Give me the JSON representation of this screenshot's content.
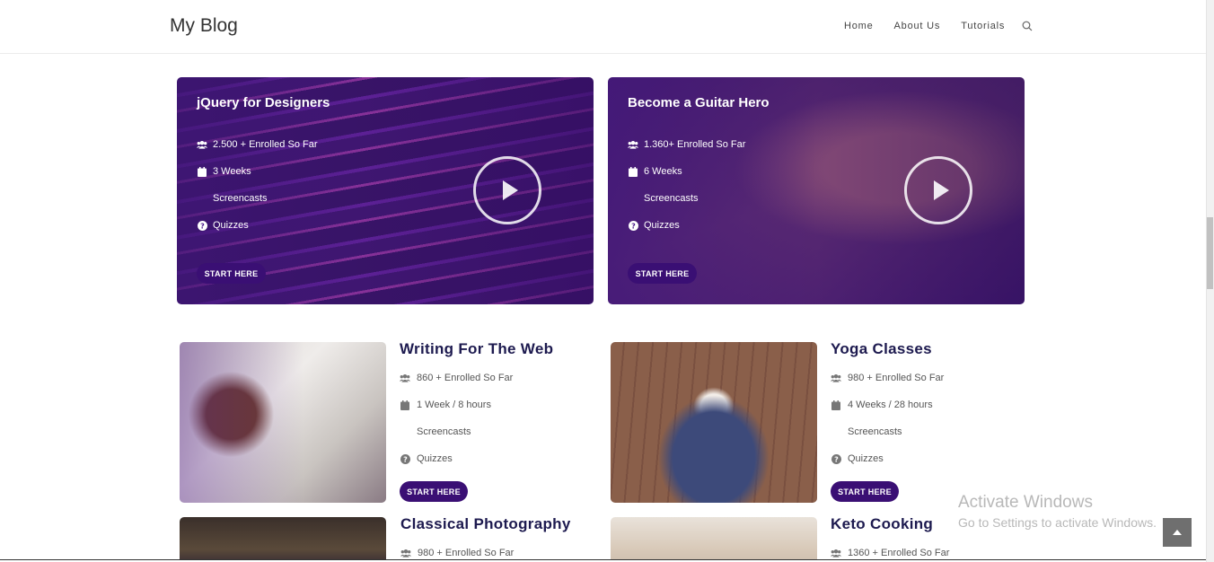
{
  "header": {
    "logo": "My Blog",
    "nav": [
      "Home",
      "About Us",
      "Tutorials"
    ],
    "search_icon": "search-icon"
  },
  "featured": [
    {
      "title": "jQuery for Designers",
      "enrolled": "2.500 + Enrolled So Far",
      "duration": "3 Weeks",
      "screencasts": "Screencasts",
      "quizzes": "Quizzes",
      "button": "START HERE"
    },
    {
      "title": "Become a Guitar Hero",
      "enrolled": "1.360+ Enrolled So Far",
      "duration": "6 Weeks",
      "screencasts": "Screencasts",
      "quizzes": "Quizzes",
      "button": "START HERE"
    }
  ],
  "courses": [
    {
      "title": "Writing For The Web",
      "enrolled": "860 + Enrolled So Far",
      "duration": "1 Week / 8 hours",
      "screencasts": "Screencasts",
      "quizzes": "Quizzes",
      "button": "START HERE"
    },
    {
      "title": "Yoga Classes",
      "enrolled": "980 + Enrolled So Far",
      "duration": "4 Weeks / 28 hours",
      "screencasts": "Screencasts",
      "quizzes": "Quizzes",
      "button": "START HERE"
    },
    {
      "title": "Classical Photography",
      "enrolled": "980 + Enrolled So Far"
    },
    {
      "title": "Keto Cooking",
      "enrolled": "1360 + Enrolled So Far"
    }
  ],
  "watermark": {
    "line1": "Activate Windows",
    "line2": "Go to Settings to activate Windows."
  },
  "colors": {
    "button_bg": "#3a0f74",
    "title": "#1d1a4f",
    "hero_overlay": "#4a1a8a"
  }
}
